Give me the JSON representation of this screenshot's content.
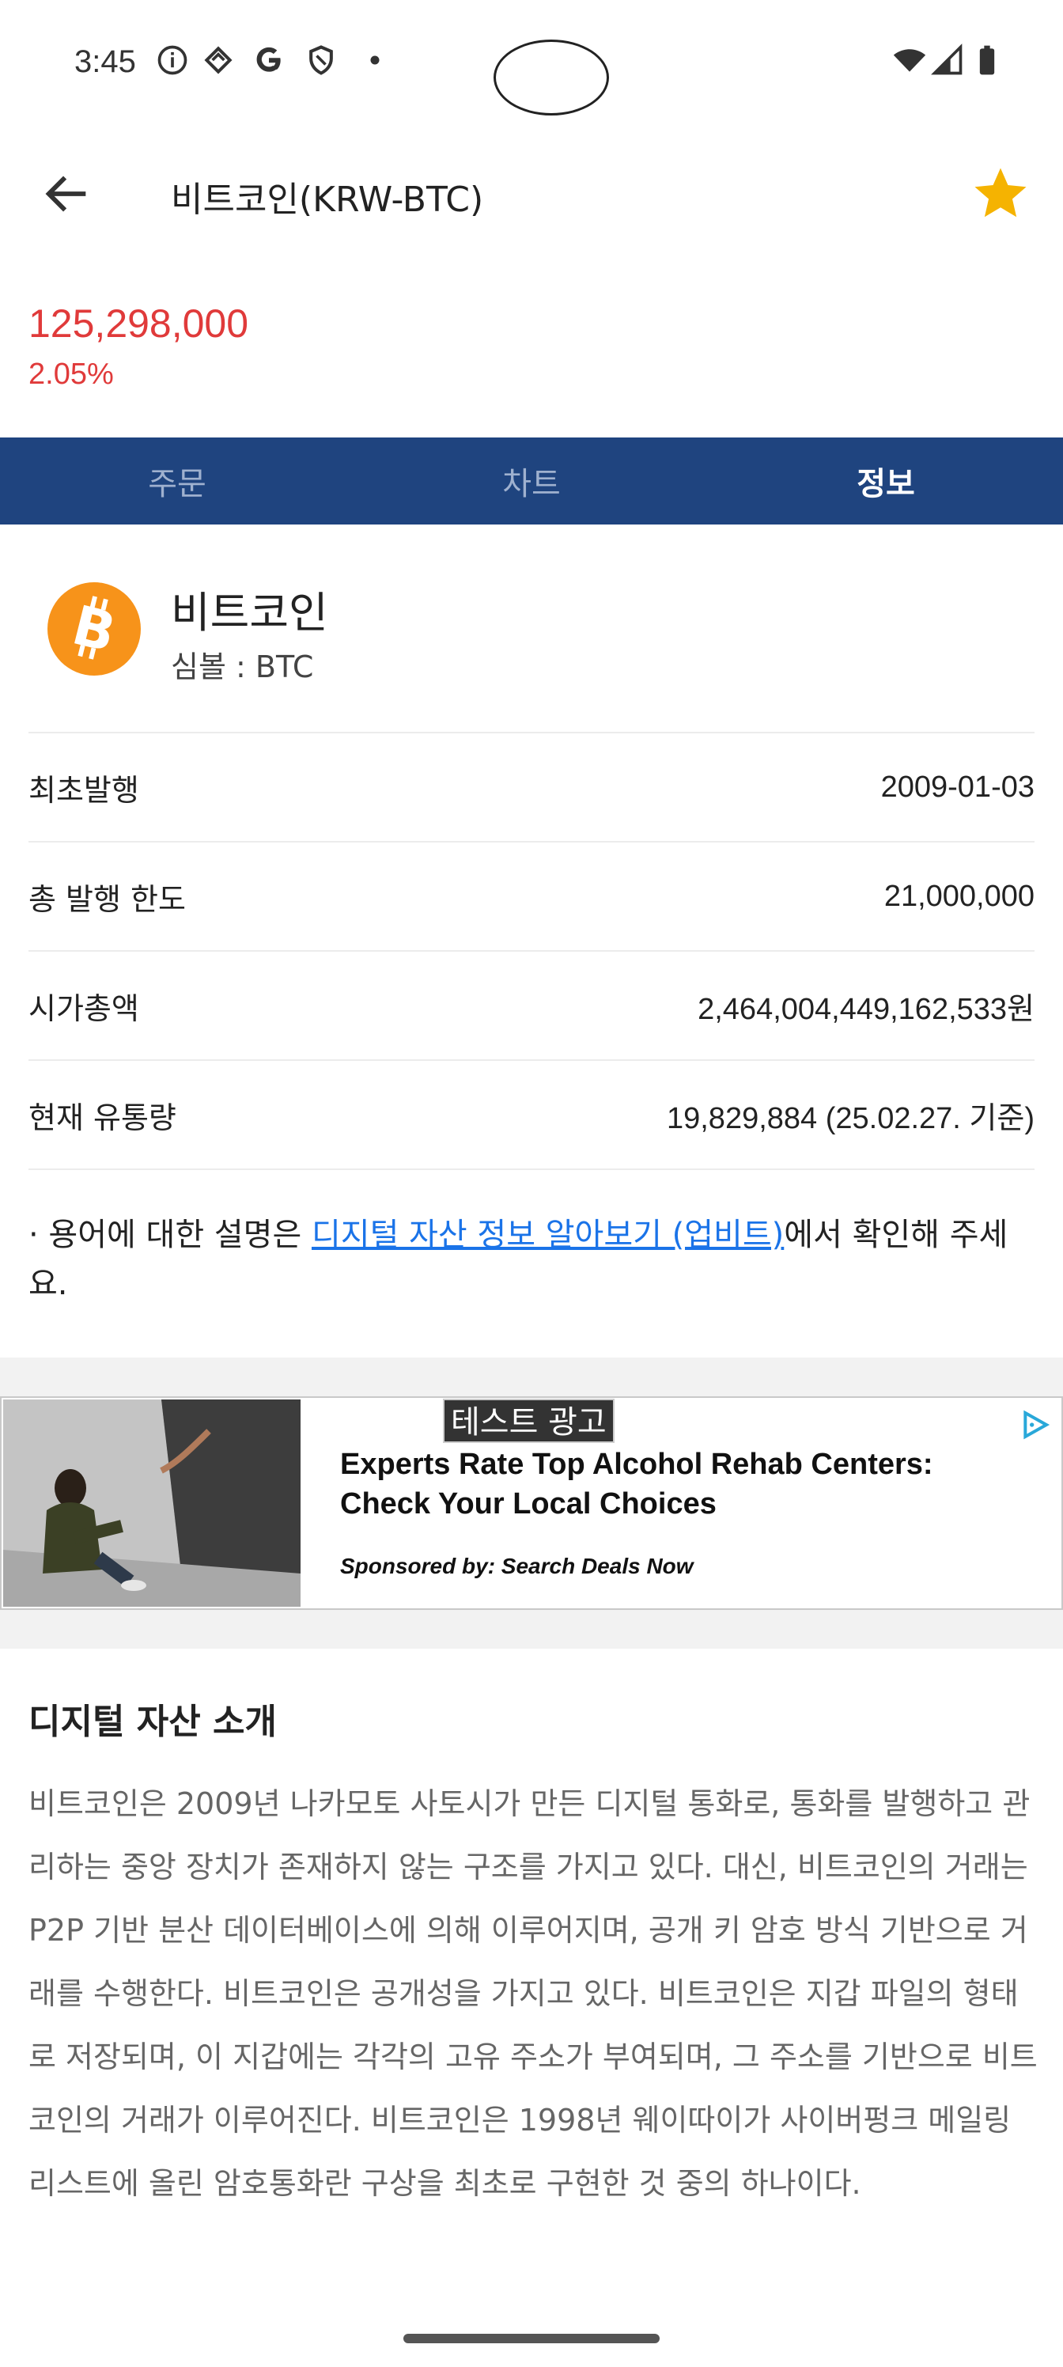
{
  "status_bar": {
    "time": "3:45",
    "left_icons": [
      "info-icon",
      "diamond-icon",
      "google-icon",
      "shield-icon",
      "dot-icon"
    ],
    "right_icons": [
      "wifi-icon",
      "signal-icon",
      "battery-icon"
    ]
  },
  "app_bar": {
    "title": "비트코인(KRW-BTC)",
    "back_icon": "back-arrow-icon",
    "favorite_icon": "star-icon",
    "favorite_color": "#f5b301"
  },
  "price": {
    "current": "125,298,000",
    "change": "2.05%",
    "color": "#e03a3a"
  },
  "tabs": [
    {
      "label": "주문",
      "active": false
    },
    {
      "label": "차트",
      "active": false
    },
    {
      "label": "정보",
      "active": true
    }
  ],
  "tab_bar_color": "#1f447f",
  "coin": {
    "name": "비트코인",
    "symbol_line": "심볼 : BTC",
    "logo_icon": "bitcoin-icon",
    "logo_color": "#f7931a"
  },
  "info_rows": [
    {
      "label": "최초발행",
      "value": "2009-01-03"
    },
    {
      "label": "총 발행 한도",
      "value": "21,000,000"
    },
    {
      "label": "시가총액",
      "value": "2,464,004,449,162,533원"
    },
    {
      "label": "현재 유통량",
      "value": "19,829,884 (25.02.27. 기준)"
    }
  ],
  "note": {
    "prefix": "· 용어에 대한 설명은 ",
    "link": "디지털 자산 정보 알아보기 (업비트)",
    "suffix": "에서 확인해 주세요."
  },
  "ad": {
    "badge": "테스트 광고",
    "headline": "Experts Rate Top Alcohol Rehab Centers: Check Your Local Choices",
    "sponsor": "Sponsored by: Search Deals Now",
    "choices_icon": "ad-choices-icon"
  },
  "intro": {
    "title": "디지털 자산 소개",
    "body": "비트코인은 2009년 나카모토 사토시가 만든 디지털 통화로, 통화를 발행하고 관리하는 중앙 장치가 존재하지 않는 구조를 가지고 있다. 대신, 비트코인의 거래는 P2P 기반 분산 데이터베이스에 의해 이루어지며, 공개 키 암호 방식 기반으로 거래를 수행한다. 비트코인은 공개성을 가지고 있다. 비트코인은 지갑 파일의 형태로 저장되며, 이 지갑에는 각각의 고유 주소가 부여되며, 그 주소를 기반으로 비트코인의 거래가 이루어진다. 비트코인은 1998년 웨이따이가 사이버펑크 메일링 리스트에 올린 암호통화란 구상을 최초로 구현한 것 중의 하나이다."
  }
}
